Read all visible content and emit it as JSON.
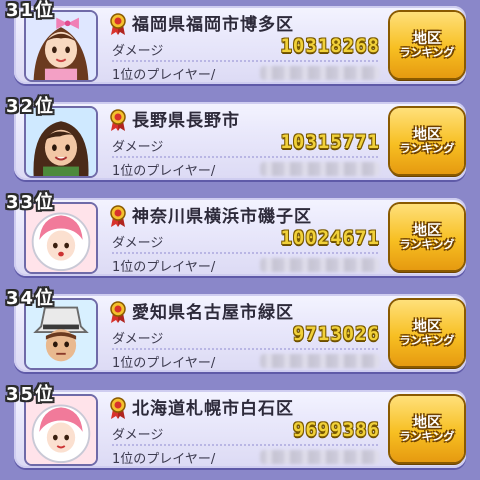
{
  "rows": [
    {
      "rank": "31位",
      "region": "福岡県福岡市博多区",
      "damage_label": "ダメージ",
      "damage": "10318268",
      "player_label": "1位のプレイヤー/",
      "button_line1": "地区",
      "button_line2": "ランキング",
      "avatar": "woman-pink-bow-avatar",
      "avatar_bg": "#dfe7ff"
    },
    {
      "rank": "32位",
      "region": "長野県長野市",
      "damage_label": "ダメージ",
      "damage": "10315771",
      "player_label": "1位のプレイヤー/",
      "button_line1": "地区",
      "button_line2": "ランキング",
      "avatar": "woman-brown-hair-avatar",
      "avatar_bg": "#cfe9ff"
    },
    {
      "rank": "33位",
      "region": "神奈川県横浜市磯子区",
      "damage_label": "ダメージ",
      "damage": "10024671",
      "player_label": "1位のプレイヤー/",
      "button_line1": "地区",
      "button_line2": "ランキング",
      "avatar": "pink-hair-helmet-avatar",
      "avatar_bg": "#ffe3ea"
    },
    {
      "rank": "34位",
      "region": "愛知県名古屋市緑区",
      "damage_label": "ダメージ",
      "damage": "9713026",
      "player_label": "1位のプレイヤー/",
      "button_line1": "地区",
      "button_line2": "ランキング",
      "avatar": "hat-explorer-avatar",
      "avatar_bg": "#d8f0ff"
    },
    {
      "rank": "35位",
      "region": "北海道札幌市白石区",
      "damage_label": "ダメージ",
      "damage": "9699386",
      "player_label": "1位のプレイヤー/",
      "button_line1": "地区",
      "button_line2": "ランキング",
      "avatar": "pink-hair-helmet-avatar",
      "avatar_bg": "#ffe3ea"
    }
  ],
  "colors": {
    "background": "#8a87c9",
    "damage_text": "#f1d13a",
    "button_gold": "#f7bf22",
    "medal_red": "#d8322c"
  }
}
